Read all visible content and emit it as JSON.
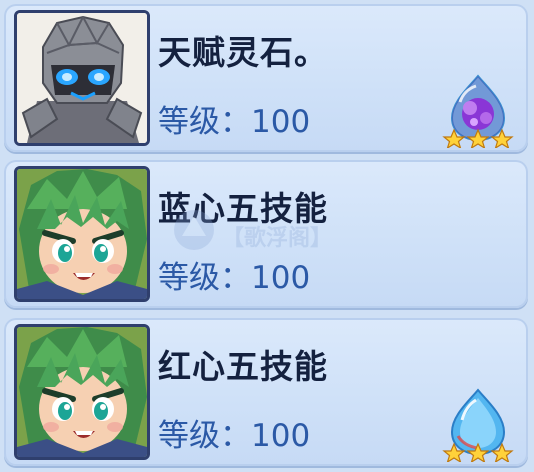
{
  "cards": [
    {
      "name": "天赋灵石。",
      "level_label": "等级：",
      "level_value": "100",
      "portrait": "stone-golem-portrait",
      "gem": "purple-crystal-gem",
      "stars": 3,
      "accent": "#2b59a6"
    },
    {
      "name": "蓝心五技能",
      "level_label": "等级：",
      "level_value": "100",
      "portrait": "green-hair-hero-portrait",
      "gem": null,
      "stars": 0,
      "accent": "#2b59a6"
    },
    {
      "name": "红心五技能",
      "level_label": "等级：",
      "level_value": "100",
      "portrait": "green-hair-hero-portrait",
      "gem": "blue-water-drop-gem",
      "stars": 3,
      "accent": "#2b59a6"
    }
  ],
  "watermark": {
    "text": "【歌浮阁】"
  },
  "colors": {
    "card_bg": "#d6e6fa",
    "name_text": "#14213f",
    "level_text": "#2b59a6",
    "star": "#ffd23a"
  }
}
